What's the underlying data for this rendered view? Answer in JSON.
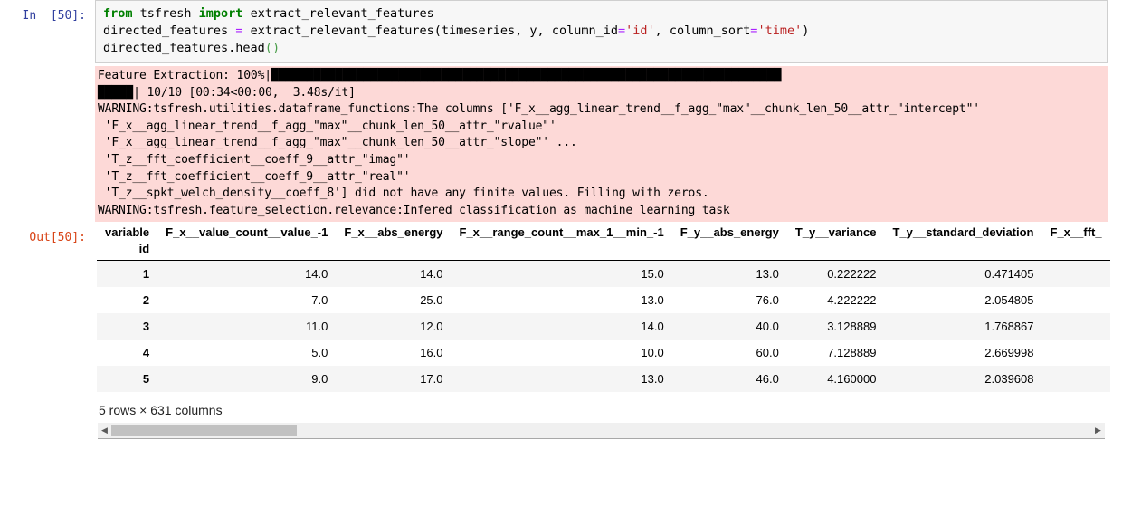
{
  "cell": {
    "input_prompt": "In  [50]:",
    "output_prompt": "Out[50]:",
    "code_lines": [
      "from tsfresh import extract_relevant_features",
      "directed_features = extract_relevant_features(timeseries, y, column_id='id', column_sort='time')",
      "directed_features.head()"
    ],
    "code_tokens": {
      "kw_from": "from",
      "mod_tsfresh": " tsfresh ",
      "kw_import": "import",
      "fn_extract": " extract_relevant_features",
      "line2_a": "directed_features ",
      "line2_eq": "=",
      "line2_b": " extract_relevant_features(timeseries, y, column_id",
      "line2_eq2": "=",
      "line2_s1": "'id'",
      "line2_c": ", column_sort",
      "line2_eq3": "=",
      "line2_s2": "'time'",
      "line2_close": ")",
      "line3_a": "directed_features.head",
      "line3_paren": "()"
    }
  },
  "stderr": {
    "progress_label": "Feature Extraction: 100%|",
    "progress_blocks_line1": "████████████████████████████████████████████████████████████████████████",
    "progress_blocks_line2": "█████",
    "progress_tail": "| 10/10 [00:34<00:00,  3.48s/it]",
    "lines": [
      "WARNING:tsfresh.utilities.dataframe_functions:The columns ['F_x__agg_linear_trend__f_agg_\"max\"__chunk_len_50__attr_\"intercept\"'",
      " 'F_x__agg_linear_trend__f_agg_\"max\"__chunk_len_50__attr_\"rvalue\"'",
      " 'F_x__agg_linear_trend__f_agg_\"max\"__chunk_len_50__attr_\"slope\"' ...",
      " 'T_z__fft_coefficient__coeff_9__attr_\"imag\"'",
      " 'T_z__fft_coefficient__coeff_9__attr_\"real\"'",
      " 'T_z__spkt_welch_density__coeff_8'] did not have any finite values. Filling with zeros.",
      "WARNING:tsfresh.feature_selection.relevance:Infered classification as machine learning task"
    ]
  },
  "dataframe": {
    "columns_axis_name": "variable",
    "index_axis_name": "id",
    "columns": [
      "F_x__value_count__value_-1",
      "F_x__abs_energy",
      "F_x__range_count__max_1__min_-1",
      "F_y__abs_energy",
      "T_y__variance",
      "T_y__standard_deviation",
      "F_x__fft_"
    ],
    "rows": [
      {
        "id": "1",
        "values": [
          "14.0",
          "14.0",
          "15.0",
          "13.0",
          "0.222222",
          "0.471405",
          ""
        ]
      },
      {
        "id": "2",
        "values": [
          "7.0",
          "25.0",
          "13.0",
          "76.0",
          "4.222222",
          "2.054805",
          ""
        ]
      },
      {
        "id": "3",
        "values": [
          "11.0",
          "12.0",
          "14.0",
          "40.0",
          "3.128889",
          "1.768867",
          ""
        ]
      },
      {
        "id": "4",
        "values": [
          "5.0",
          "16.0",
          "10.0",
          "60.0",
          "7.128889",
          "2.669998",
          ""
        ]
      },
      {
        "id": "5",
        "values": [
          "9.0",
          "17.0",
          "13.0",
          "46.0",
          "4.160000",
          "2.039608",
          ""
        ]
      }
    ],
    "shape_label": "5 rows × 631 columns"
  },
  "scrollbar": {
    "left_arrow": "◀",
    "right_arrow": "▶"
  },
  "colors": {
    "stderr_background": "#fdd9d7",
    "code_background": "#f7f7f7",
    "in_prompt": "#303f9f",
    "out_prompt": "#d84315",
    "row_stripe": "#f5f5f5"
  }
}
